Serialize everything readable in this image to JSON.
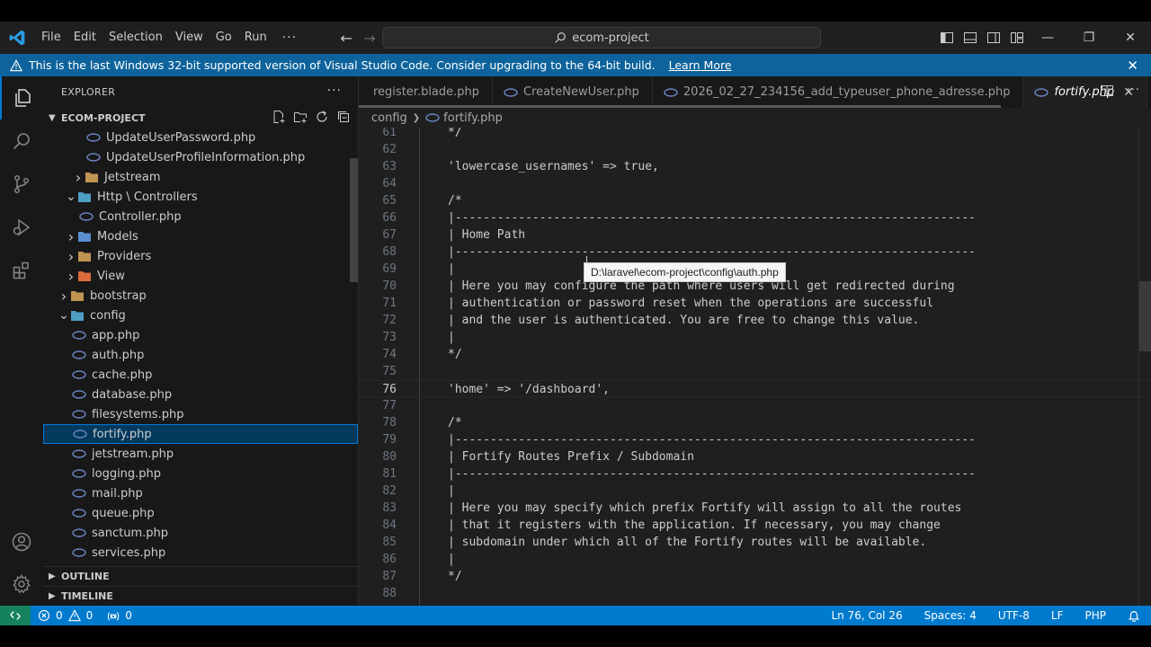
{
  "menu": [
    "File",
    "Edit",
    "Selection",
    "View",
    "Go",
    "Run"
  ],
  "command_center": "ecom-project",
  "banner": {
    "message": "This is the last Windows 32-bit supported version of Visual Studio Code. Consider upgrading to the 64-bit build.",
    "link": "Learn More"
  },
  "sidebar": {
    "title": "EXPLORER",
    "project": "ECOM-PROJECT",
    "tree": [
      {
        "label": "UpdateUserPassword.php",
        "level": 5,
        "kind": "php"
      },
      {
        "label": "UpdateUserProfileInformation.php",
        "level": 5,
        "kind": "php"
      },
      {
        "label": "Jetstream",
        "level": 3,
        "kind": "folder",
        "open": false
      },
      {
        "label": "Http \\ Controllers",
        "level": 2,
        "kind": "folder-http",
        "open": true
      },
      {
        "label": "Controller.php",
        "level": 4,
        "kind": "php"
      },
      {
        "label": "Models",
        "level": 2,
        "kind": "folder-models",
        "open": false
      },
      {
        "label": "Providers",
        "level": 2,
        "kind": "folder",
        "open": false
      },
      {
        "label": "View",
        "level": 2,
        "kind": "folder-view",
        "open": false
      },
      {
        "label": "bootstrap",
        "level": 1,
        "kind": "folder",
        "open": false
      },
      {
        "label": "config",
        "level": 1,
        "kind": "folder-config",
        "open": true
      },
      {
        "label": "app.php",
        "level": 3,
        "kind": "php"
      },
      {
        "label": "auth.php",
        "level": 3,
        "kind": "php",
        "hover": true
      },
      {
        "label": "cache.php",
        "level": 3,
        "kind": "php"
      },
      {
        "label": "database.php",
        "level": 3,
        "kind": "php"
      },
      {
        "label": "filesystems.php",
        "level": 3,
        "kind": "php"
      },
      {
        "label": "fortify.php",
        "level": 3,
        "kind": "php",
        "selected": true
      },
      {
        "label": "jetstream.php",
        "level": 3,
        "kind": "php"
      },
      {
        "label": "logging.php",
        "level": 3,
        "kind": "php"
      },
      {
        "label": "mail.php",
        "level": 3,
        "kind": "php"
      },
      {
        "label": "queue.php",
        "level": 3,
        "kind": "php"
      },
      {
        "label": "sanctum.php",
        "level": 3,
        "kind": "php"
      },
      {
        "label": "services.php",
        "level": 3,
        "kind": "php"
      }
    ],
    "outline": "OUTLINE",
    "timeline": "TIMELINE"
  },
  "tabs": [
    {
      "label": "register.blade.php",
      "kind": "blade"
    },
    {
      "label": "CreateNewUser.php",
      "kind": "php"
    },
    {
      "label": "2026_02_27_234156_add_typeuser_phone_adresse.php",
      "kind": "php"
    },
    {
      "label": "fortify.php",
      "kind": "php",
      "active": true
    }
  ],
  "breadcrumb": [
    "config",
    "fortify.php"
  ],
  "code_lines": [
    {
      "n": "61",
      "t": "*/"
    },
    {
      "n": "62",
      "t": ""
    },
    {
      "n": "63",
      "t": "'lowercase_usernames' => true,"
    },
    {
      "n": "64",
      "t": ""
    },
    {
      "n": "65",
      "t": "/*"
    },
    {
      "n": "66",
      "t": "|--------------------------------------------------------------------------"
    },
    {
      "n": "67",
      "t": "| Home Path"
    },
    {
      "n": "68",
      "t": "|--------------------------------------------------------------------------"
    },
    {
      "n": "69",
      "t": "|"
    },
    {
      "n": "70",
      "t": "| Here you may configure the path where users will get redirected during"
    },
    {
      "n": "71",
      "t": "| authentication or password reset when the operations are successful"
    },
    {
      "n": "72",
      "t": "| and the user is authenticated. You are free to change this value."
    },
    {
      "n": "73",
      "t": "|"
    },
    {
      "n": "74",
      "t": "*/"
    },
    {
      "n": "75",
      "t": ""
    },
    {
      "n": "76",
      "t": "'home' => '/dashboard',",
      "current": true
    },
    {
      "n": "77",
      "t": ""
    },
    {
      "n": "78",
      "t": "/*"
    },
    {
      "n": "79",
      "t": "|--------------------------------------------------------------------------"
    },
    {
      "n": "80",
      "t": "| Fortify Routes Prefix / Subdomain"
    },
    {
      "n": "81",
      "t": "|--------------------------------------------------------------------------"
    },
    {
      "n": "82",
      "t": "|"
    },
    {
      "n": "83",
      "t": "| Here you may specify which prefix Fortify will assign to all the routes"
    },
    {
      "n": "84",
      "t": "| that it registers with the application. If necessary, you may change"
    },
    {
      "n": "85",
      "t": "| subdomain under which all of the Fortify routes will be available."
    },
    {
      "n": "86",
      "t": "|"
    },
    {
      "n": "87",
      "t": "*/"
    },
    {
      "n": "88",
      "t": ""
    }
  ],
  "tooltip": "D:\\laravel\\ecom-project\\config\\auth.php",
  "status": {
    "errors": "0",
    "warnings": "0",
    "ports": "0",
    "position": "Ln 76, Col 26",
    "spaces": "Spaces: 4",
    "encoding": "UTF-8",
    "eol": "LF",
    "language": "PHP"
  },
  "colors": {
    "accent": "#007acc",
    "banner": "#0e639c",
    "selection": "#04395e",
    "php_icon": "#6c87c7",
    "folder": "#c09553"
  }
}
